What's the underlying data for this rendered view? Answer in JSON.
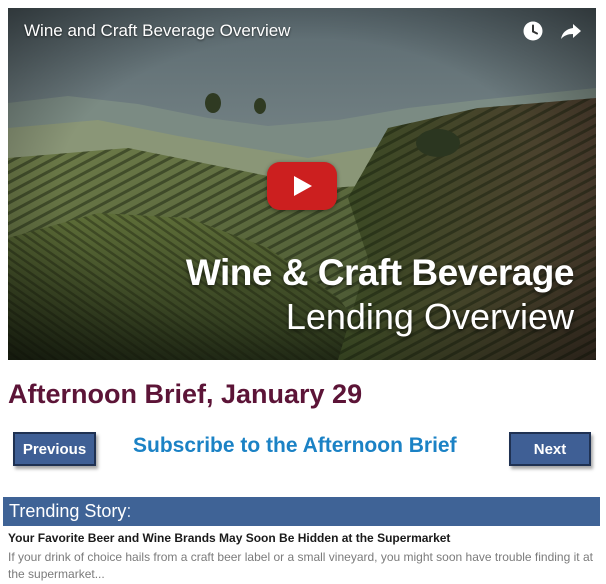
{
  "video": {
    "title": "Wine and Craft Beverage Overview",
    "overlay_line1": "Wine & Craft Beverage",
    "overlay_line2": "Lending Overview",
    "icons": [
      "watch-later-icon",
      "share-icon",
      "play-icon"
    ],
    "play_color": "#cc1f1f"
  },
  "brief": {
    "title": "Afternoon Brief, January 29",
    "title_color": "#5c1437"
  },
  "nav": {
    "previous_label": "Previous",
    "next_label": "Next",
    "subscribe_label": "Subscribe to the Afternoon Brief",
    "button_color": "#3f5f95",
    "link_color": "#1b82c5"
  },
  "trending": {
    "label": "Trending Story",
    "colon": ":",
    "bar_color": "#3f6396",
    "story_title": "Your Favorite Beer and Wine Brands May Soon Be Hidden at the Supermarket",
    "story_excerpt": "If your drink of choice hails from a craft beer label or a small vineyard, you might soon have trouble finding it at the supermarket..."
  }
}
